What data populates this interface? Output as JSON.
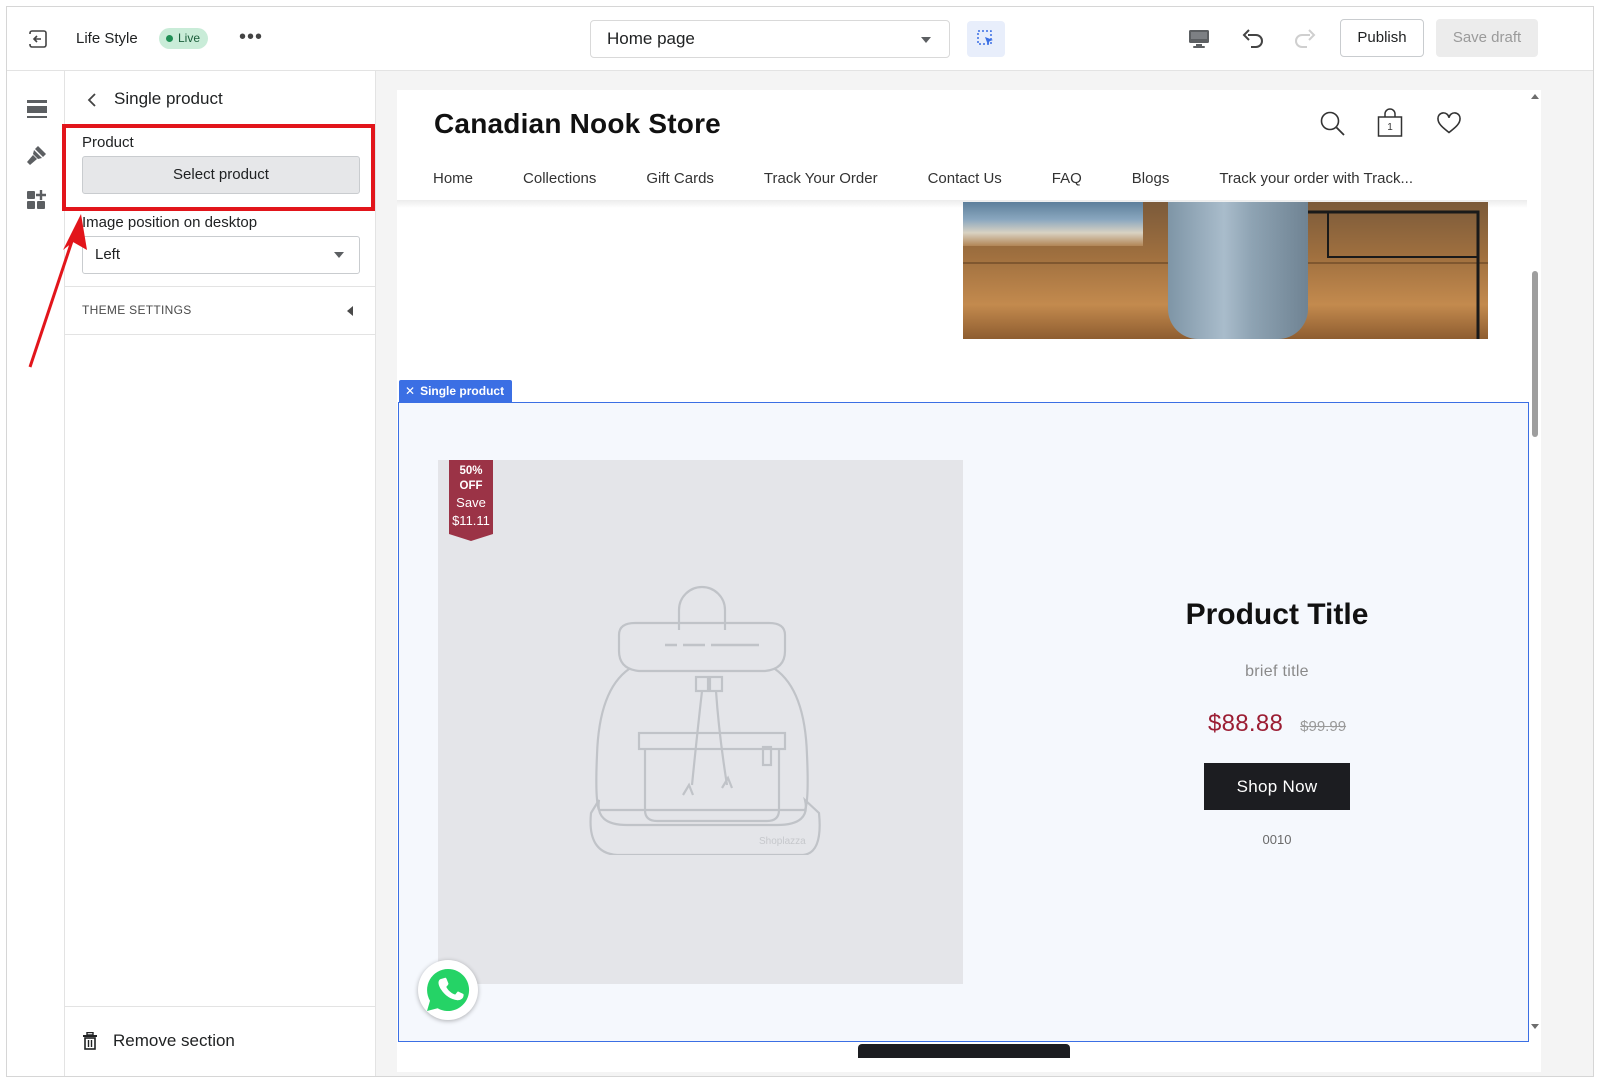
{
  "topbar": {
    "store_name": "Life Style",
    "status_badge": "Live",
    "more_label": "•••",
    "page_selector": "Home page",
    "publish_label": "Publish",
    "save_draft_label": "Save draft"
  },
  "panel": {
    "title": "Single product",
    "product_label": "Product",
    "select_product_label": "Select product",
    "image_position_label": "Image position on desktop",
    "image_position_value": "Left",
    "theme_settings_label": "THEME SETTINGS",
    "remove_section_label": "Remove section",
    "highlight_color": "#e2151b"
  },
  "preview": {
    "store_name": "Canadian Nook Store",
    "cart_count": "1",
    "nav": [
      "Home",
      "Collections",
      "Gift Cards",
      "Track Your Order",
      "Contact Us",
      "FAQ",
      "Blogs",
      "Track your order with Track..."
    ],
    "section_tag": "Single product",
    "badge": {
      "line1": "50%",
      "line2": "OFF",
      "line3": "Save",
      "line4": "$11.11",
      "color": "#9b3346"
    },
    "image_watermark": "Shoplazza",
    "product": {
      "title": "Product Title",
      "brief": "brief title",
      "price": "$88.88",
      "compare_price": "$99.99",
      "button_label": "Shop Now",
      "sku": "0010"
    }
  },
  "colors": {
    "accent_blue": "#3b6fe4",
    "price_red": "#9b1d33",
    "live_green": "#1f8f55"
  }
}
